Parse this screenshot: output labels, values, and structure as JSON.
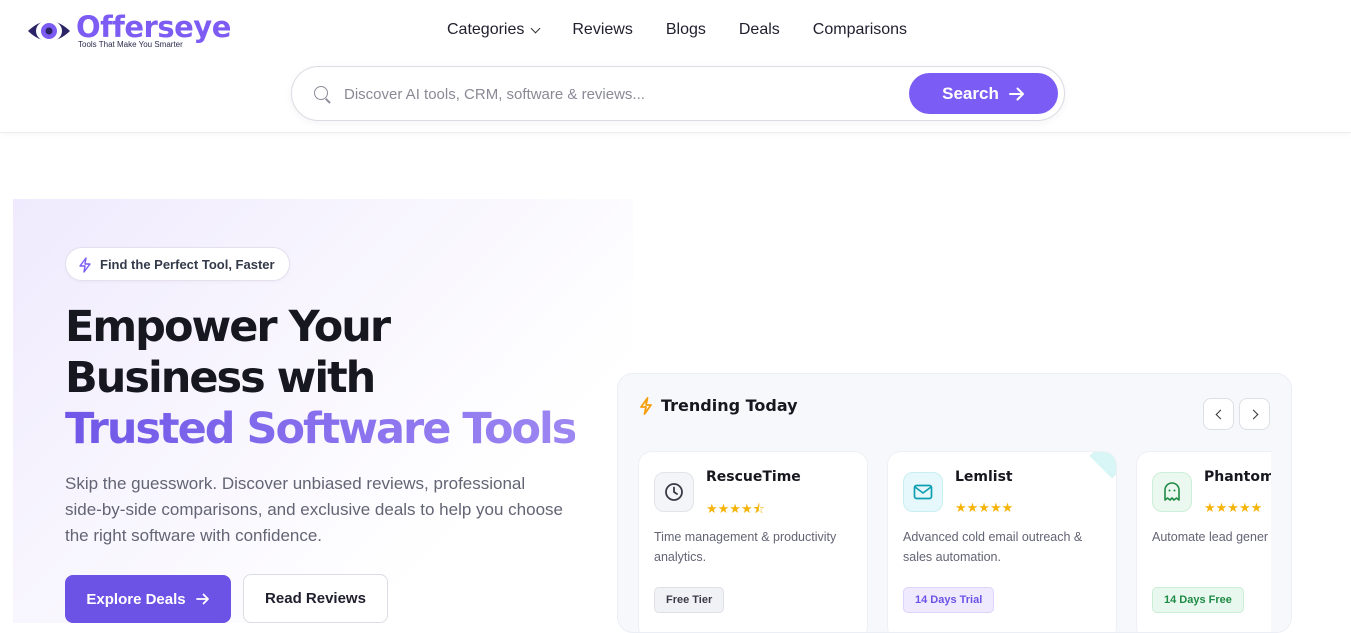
{
  "brand": {
    "name": "Offerseye",
    "tagline": "Tools That Make You Smarter",
    "color": "#7c5cf3"
  },
  "nav": {
    "items": [
      "Categories",
      "Reviews",
      "Blogs",
      "Deals",
      "Comparisons"
    ]
  },
  "search": {
    "placeholder": "Discover AI tools, CRM, software & reviews...",
    "button_label": "Search"
  },
  "hero": {
    "badge": "Find the Perfect Tool, Faster",
    "headline_line1": "Empower Your",
    "headline_line2": "Business with",
    "headline_accent": "Trusted Software Tools",
    "subtext": "Skip the guesswork. Discover unbiased reviews, professional side-by-side comparisons, and exclusive deals to help you choose the right software with confidence.",
    "primary_button": "Explore Deals",
    "secondary_button": "Read Reviews"
  },
  "trending": {
    "title": "Trending Today",
    "cards": [
      {
        "name": "RescueTime",
        "rating": 4.5,
        "stars": "★★★★⯪",
        "description": "Time management & productivity analytics.",
        "tag": "Free Tier",
        "icon": "clock-icon",
        "tag_bg": "#f1f2f5",
        "tag_color": "#3a3b48",
        "icon_bg": "#f4f5f8",
        "accent": "#eef0f5"
      },
      {
        "name": "Lemlist",
        "rating": 5,
        "stars": "★★★★★",
        "description": "Advanced cold email outreach & sales automation.",
        "tag": "14 Days Trial",
        "icon": "mail-icon",
        "tag_bg": "#efeafd",
        "tag_color": "#6d52e6",
        "icon_bg": "#e6f8fb",
        "accent": "#d9f6f6"
      },
      {
        "name": "Phantom",
        "rating": 5,
        "stars": "★★★★★",
        "description": "Automate lead gener extraction.",
        "tag": "14 Days Free",
        "icon": "ghost-icon",
        "tag_bg": "#e9f8ee",
        "tag_color": "#1f8a45",
        "icon_bg": "#eaf8ef",
        "accent": "#eaf8ef"
      }
    ]
  }
}
